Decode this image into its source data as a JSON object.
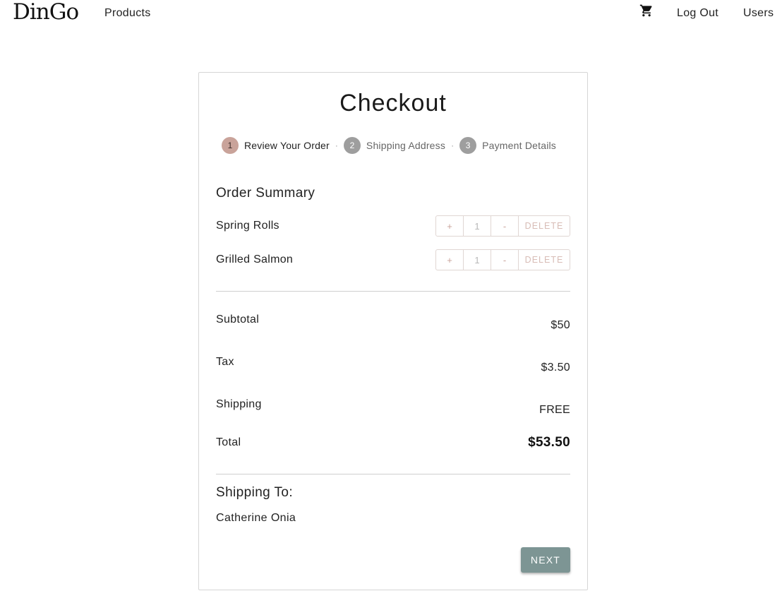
{
  "nav": {
    "logo": "DinGo",
    "products_label": "Products",
    "cart_icon": "shopping-cart-icon",
    "logout_label": "Log Out",
    "users_label": "Users"
  },
  "checkout": {
    "title": "Checkout",
    "steps": [
      {
        "number": "1",
        "label": "Review Your Order",
        "active": true
      },
      {
        "number": "2",
        "label": "Shipping Address",
        "active": false
      },
      {
        "number": "3",
        "label": "Payment Details",
        "active": false
      }
    ],
    "step_separator": "·"
  },
  "order_summary": {
    "title": "Order Summary",
    "items": [
      {
        "name": "Spring Rolls",
        "quantity": "1"
      },
      {
        "name": "Grilled Salmon",
        "quantity": "1"
      }
    ],
    "plus_label": "+",
    "minus_label": "-",
    "delete_label": "DELETE"
  },
  "totals": {
    "subtotal_label": "Subtotal",
    "subtotal_value": "$50",
    "tax_label": "Tax",
    "tax_value": "$3.50",
    "shipping_label": "Shipping",
    "shipping_value": "FREE",
    "total_label": "Total",
    "total_value": "$53.50"
  },
  "shipping_to": {
    "title": "Shipping To:",
    "name": "Catherine Onia"
  },
  "actions": {
    "next_label": "NEXT"
  },
  "colors": {
    "accent_step": "#c9a39a",
    "inactive_step": "#9e9e9e",
    "next_button": "#7d9594",
    "delete_text": "#d8bcb6"
  }
}
